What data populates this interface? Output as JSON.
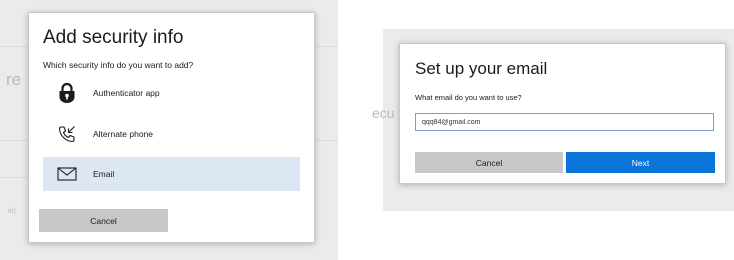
{
  "background_left": {
    "ghost_text_1": "re",
    "ghost_text_2": "in)"
  },
  "background_right": {
    "ghost_text_1": "ecu"
  },
  "add_security_dialog": {
    "title": "Add security info",
    "subtitle": "Which security info do you want to add?",
    "options": [
      {
        "label": "Authenticator app",
        "icon": "authenticator-lock-icon",
        "selected": false
      },
      {
        "label": "Alternate phone",
        "icon": "phone-call-icon",
        "selected": false
      },
      {
        "label": "Email",
        "icon": "envelope-icon",
        "selected": true
      }
    ],
    "cancel_label": "Cancel"
  },
  "email_dialog": {
    "title": "Set up your email",
    "subtitle": "What email do you want to use?",
    "email_value": "qqq84@gmail.com",
    "cancel_label": "Cancel",
    "next_label": "Next"
  },
  "colors": {
    "accent": "#0a74d8",
    "selected_row": "#dde6f3",
    "button_gray": "#c8c8c8",
    "backdrop": "#ebebeb"
  }
}
